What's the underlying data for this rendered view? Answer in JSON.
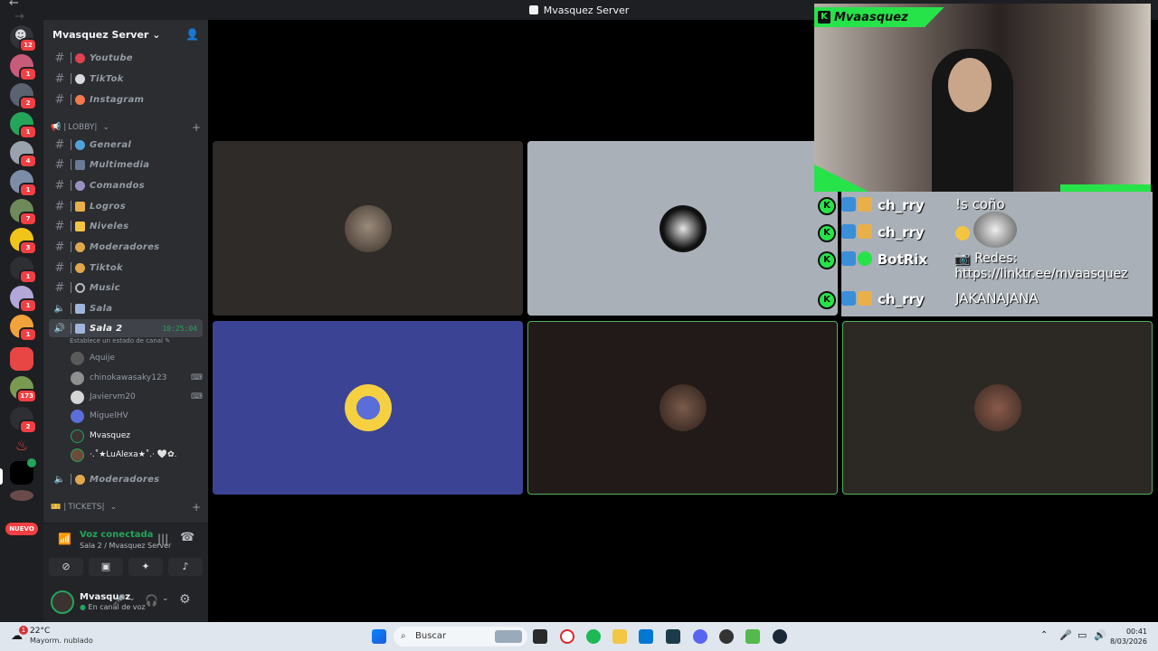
{
  "window": {
    "title": "Mvasquez Server",
    "back": "←",
    "forward": "→"
  },
  "server": {
    "name": "Mvasquez Server",
    "chevron": "⌄"
  },
  "rail": {
    "badges": [
      "12",
      "1",
      "2",
      "1",
      "4",
      "1",
      "7",
      "3",
      "1",
      "1",
      "1",
      "173",
      "2"
    ],
    "nuevo": "NUEVO"
  },
  "channels": [
    {
      "name": "Youtube",
      "color": "#e0434f"
    },
    {
      "name": "TikTok",
      "color": "#d9d9e3"
    },
    {
      "name": "Instagram",
      "color": "#f07a4e"
    }
  ],
  "lobby": {
    "label": "LOBBY",
    "plus": "+"
  },
  "lobby_channels": [
    {
      "name": "General",
      "color": "#4fa3d9"
    },
    {
      "name": "Multimedia",
      "color": "#6b7a99"
    },
    {
      "name": "Comandos",
      "color": "#9a8fc2"
    },
    {
      "name": "Logros",
      "color": "#e8b04b"
    },
    {
      "name": "Niveles",
      "color": "#f5c542"
    },
    {
      "name": "Moderadores",
      "color": "#e0a84b"
    },
    {
      "name": "Tiktok",
      "color": "#e0a84b"
    },
    {
      "name": "Music",
      "color": "#b5bac1"
    }
  ],
  "voice": {
    "sala": "Sala",
    "sala2": "Sala 2",
    "timer": "10:25:04",
    "status_hint": "Establece un estado de canal",
    "moderadores": "Moderadores"
  },
  "voice_users": [
    "Aquije",
    "chinokawasaky123",
    "Javiervm20",
    "MiguelHV",
    "Mvasquez",
    "·.˚★LuAlexa★˚.· 🤍✿."
  ],
  "tickets": {
    "label": "TICKETS",
    "plus": "+"
  },
  "panel": {
    "status": "Voz conectada",
    "sub": "Sala 2 / Mvasquez Server",
    "username": "Mvasquez",
    "userstatus": "En canal de voz"
  },
  "overlay": {
    "streamer": "Mvaasquez",
    "logo": "K",
    "messages": [
      {
        "nick": "ch_rry",
        "text": "!s coño"
      },
      {
        "nick": "ch_rry",
        "text": ""
      },
      {
        "nick": "BotRix",
        "text": "📷 Redes: https://linktr.ee/mvaasquez"
      },
      {
        "nick": "ch_rry",
        "text": "JAKANAJANA"
      }
    ]
  },
  "taskbar": {
    "temp": "22°C",
    "weather": "Mayorm. nublado",
    "weather_badge": "1",
    "search": "Buscar",
    "time": "00:41",
    "date": "8/03/2026"
  },
  "colors": {
    "speaking": "#4fb05c",
    "accent": "#27e34a",
    "danger": "#f23f43"
  }
}
